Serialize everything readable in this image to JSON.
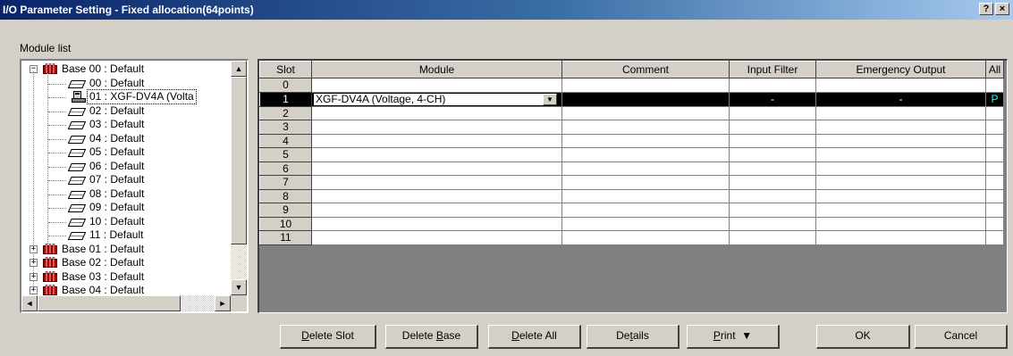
{
  "window": {
    "title": "I/O Parameter Setting - Fixed allocation(64points)",
    "help_label": "?",
    "close_label": "×"
  },
  "module_list_label": "Module list",
  "tree": {
    "base00": {
      "label": "Base 00 : Default",
      "expander": "−"
    },
    "slots": [
      {
        "label": "00 : Default"
      },
      {
        "label": "01 : XGF-DV4A (Volta"
      },
      {
        "label": "02 : Default"
      },
      {
        "label": "03 : Default"
      },
      {
        "label": "04 : Default"
      },
      {
        "label": "05 : Default"
      },
      {
        "label": "06 : Default"
      },
      {
        "label": "07 : Default"
      },
      {
        "label": "08 : Default"
      },
      {
        "label": "09 : Default"
      },
      {
        "label": "10 : Default"
      },
      {
        "label": "11 : Default"
      }
    ],
    "bases": [
      {
        "label": "Base 01 : Default",
        "expander": "+"
      },
      {
        "label": "Base 02 : Default",
        "expander": "+"
      },
      {
        "label": "Base 03 : Default",
        "expander": "+"
      },
      {
        "label": "Base 04 : Default",
        "expander": "+"
      }
    ]
  },
  "grid": {
    "headers": [
      "Slot",
      "Module",
      "Comment",
      "Input Filter",
      "Emergency Output",
      "All"
    ],
    "rows": [
      {
        "slot": "0",
        "module": "",
        "comment": "",
        "input_filter": "",
        "emergency_output": "",
        "all": ""
      },
      {
        "slot": "1",
        "module": "XGF-DV4A (Voltage, 4-CH)",
        "comment": "",
        "input_filter": "-",
        "emergency_output": "-",
        "all": "P"
      },
      {
        "slot": "2",
        "module": "",
        "comment": "",
        "input_filter": "",
        "emergency_output": "",
        "all": ""
      },
      {
        "slot": "3",
        "module": "",
        "comment": "",
        "input_filter": "",
        "emergency_output": "",
        "all": ""
      },
      {
        "slot": "4",
        "module": "",
        "comment": "",
        "input_filter": "",
        "emergency_output": "",
        "all": ""
      },
      {
        "slot": "5",
        "module": "",
        "comment": "",
        "input_filter": "",
        "emergency_output": "",
        "all": ""
      },
      {
        "slot": "6",
        "module": "",
        "comment": "",
        "input_filter": "",
        "emergency_output": "",
        "all": ""
      },
      {
        "slot": "7",
        "module": "",
        "comment": "",
        "input_filter": "",
        "emergency_output": "",
        "all": ""
      },
      {
        "slot": "8",
        "module": "",
        "comment": "",
        "input_filter": "",
        "emergency_output": "",
        "all": ""
      },
      {
        "slot": "9",
        "module": "",
        "comment": "",
        "input_filter": "",
        "emergency_output": "",
        "all": ""
      },
      {
        "slot": "10",
        "module": "",
        "comment": "",
        "input_filter": "",
        "emergency_output": "",
        "all": ""
      },
      {
        "slot": "11",
        "module": "",
        "comment": "",
        "input_filter": "",
        "emergency_output": "",
        "all": ""
      }
    ]
  },
  "buttons": {
    "delete_slot": {
      "mnemonic": "D",
      "rest": "elete Slot"
    },
    "delete_base": {
      "pre": "Delete ",
      "mnemonic": "B",
      "rest": "ase"
    },
    "delete_all": {
      "mnemonic": "D",
      "rest": "elete All"
    },
    "details": {
      "pre": "De",
      "mnemonic": "t",
      "rest": "ails"
    },
    "print": {
      "mnemonic": "P",
      "rest": "rint",
      "arrow": "▼"
    },
    "ok": "OK",
    "cancel": "Cancel"
  },
  "colors": {
    "titlebar_start": "#0a246a",
    "titlebar_end": "#a6caf0",
    "selected_row_bg": "#000000",
    "all_flag_color": "#00ffff",
    "base_icon_color": "#c00000"
  },
  "icons": {
    "base": "rack-icon",
    "slot": "module-slot-icon",
    "selected_slot": "analog-module-icon"
  }
}
